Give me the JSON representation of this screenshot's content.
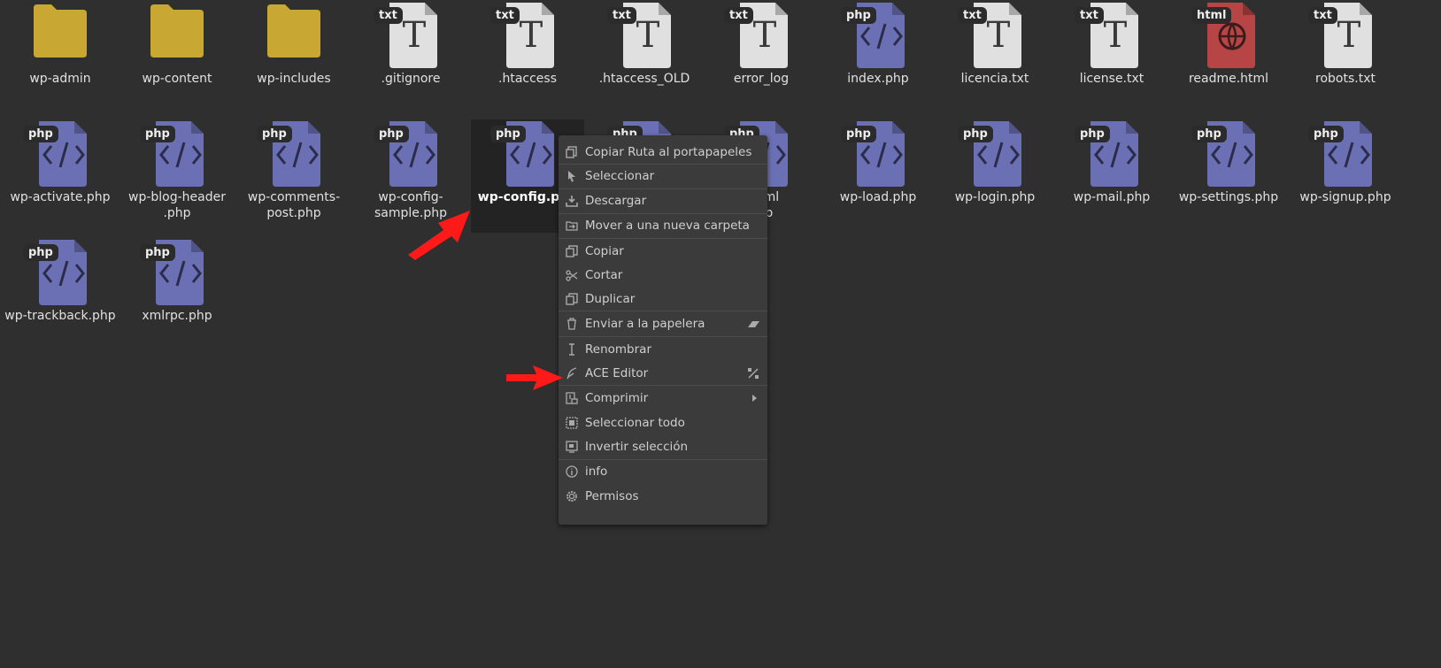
{
  "files": [
    {
      "name": "wp-admin",
      "type": "folder"
    },
    {
      "name": "wp-content",
      "type": "folder"
    },
    {
      "name": "wp-includes",
      "type": "folder"
    },
    {
      "name": ".gitignore",
      "type": "txt"
    },
    {
      "name": ".htaccess",
      "type": "txt"
    },
    {
      "name": ".htaccess_OLD",
      "type": "txt"
    },
    {
      "name": "error_log",
      "type": "txt"
    },
    {
      "name": "index.php",
      "type": "php"
    },
    {
      "name": "licencia.txt",
      "type": "txt"
    },
    {
      "name": "license.txt",
      "type": "txt"
    },
    {
      "name": "readme.html",
      "type": "html"
    },
    {
      "name": "robots.txt",
      "type": "txt"
    },
    {
      "name": "wp-activate.php",
      "type": "php"
    },
    {
      "name": "wp-blog-header\n.php",
      "type": "php"
    },
    {
      "name": "wp-comments-\npost.php",
      "type": "php"
    },
    {
      "name": "wp-config-\nsample.php",
      "type": "php"
    },
    {
      "name": "wp-config.php",
      "type": "php"
    },
    {
      "name": "",
      "type": "php"
    },
    {
      "name": "-opml\nphp",
      "type": "php"
    },
    {
      "name": "wp-load.php",
      "type": "php"
    },
    {
      "name": "wp-login.php",
      "type": "php"
    },
    {
      "name": "wp-mail.php",
      "type": "php"
    },
    {
      "name": "wp-settings.php",
      "type": "php"
    },
    {
      "name": "wp-signup.php",
      "type": "php"
    },
    {
      "name": "wp-trackback.php",
      "type": "php"
    },
    {
      "name": "xmlrpc.php",
      "type": "php"
    }
  ],
  "badges": {
    "txt": "txt",
    "php": "php",
    "html": "html"
  },
  "colors": {
    "folder": "#c8a832",
    "txt": "#e0e0e0",
    "php": "#6b70b4",
    "html": "#b84545",
    "background": "#2f2f2f",
    "arrow": "#ff1a1a"
  },
  "context_menu": {
    "items": [
      {
        "label": "Copiar Ruta al portapapeles",
        "icon": "copy-path-icon"
      },
      {
        "label": "Seleccionar",
        "icon": "cursor-icon"
      },
      {
        "label": "Descargar",
        "icon": "download-icon"
      },
      {
        "label": "Mover a una nueva carpeta",
        "icon": "move-folder-icon"
      },
      {
        "label": "Copiar",
        "icon": "copy-icon"
      },
      {
        "label": "Cortar",
        "icon": "scissors-icon"
      },
      {
        "label": "Duplicar",
        "icon": "duplicate-icon"
      },
      {
        "label": "Enviar a la papelera",
        "icon": "trash-icon",
        "right_icon": "eraser-icon"
      },
      {
        "label": "Renombrar",
        "icon": "text-cursor-icon"
      },
      {
        "label": "ACE Editor",
        "icon": "feather-icon",
        "right_icon": "percent-icon"
      },
      {
        "label": "Comprimir",
        "icon": "archive-icon",
        "right_icon": "submenu-arrow-icon"
      },
      {
        "label": "Seleccionar todo",
        "icon": "select-all-icon"
      },
      {
        "label": "Invertir selección",
        "icon": "invert-selection-icon"
      },
      {
        "label": "info",
        "icon": "info-icon"
      },
      {
        "label": "Permisos",
        "icon": "gear-icon"
      }
    ]
  }
}
